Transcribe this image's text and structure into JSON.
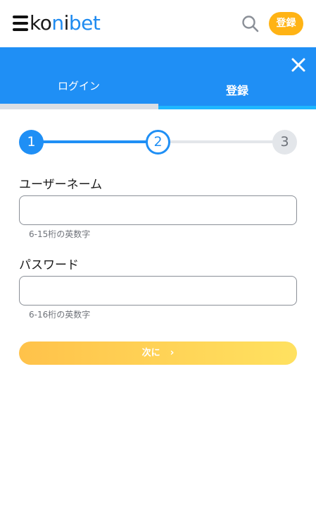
{
  "header": {
    "logo_text_dark": "ko",
    "logo_text_accent": "n",
    "logo_text_dark2": "i",
    "logo_text_accent2": "bet",
    "signup_label": "登録"
  },
  "tabs": {
    "login_label": "ログイン",
    "register_label": "登録",
    "active": "register"
  },
  "stepper": {
    "steps": [
      "1",
      "2",
      "3"
    ],
    "current": 2
  },
  "form": {
    "username": {
      "label": "ユーザーネーム",
      "value": "",
      "hint": "6-15桁の英数字"
    },
    "password": {
      "label": "パスワード",
      "value": "",
      "hint": "6-16桁の英数字"
    },
    "next_label": "次に",
    "next_chevron": "›"
  },
  "colors": {
    "primary_blue": "#1f8ff5",
    "signup_orange": "#ffb314",
    "next_gradient_start": "#ffc24a",
    "next_gradient_end": "#ffe160"
  },
  "icons": {
    "menu": "hamburger-menu-icon",
    "search": "search-icon",
    "close": "close-icon",
    "next": "chevron-right-icon"
  }
}
